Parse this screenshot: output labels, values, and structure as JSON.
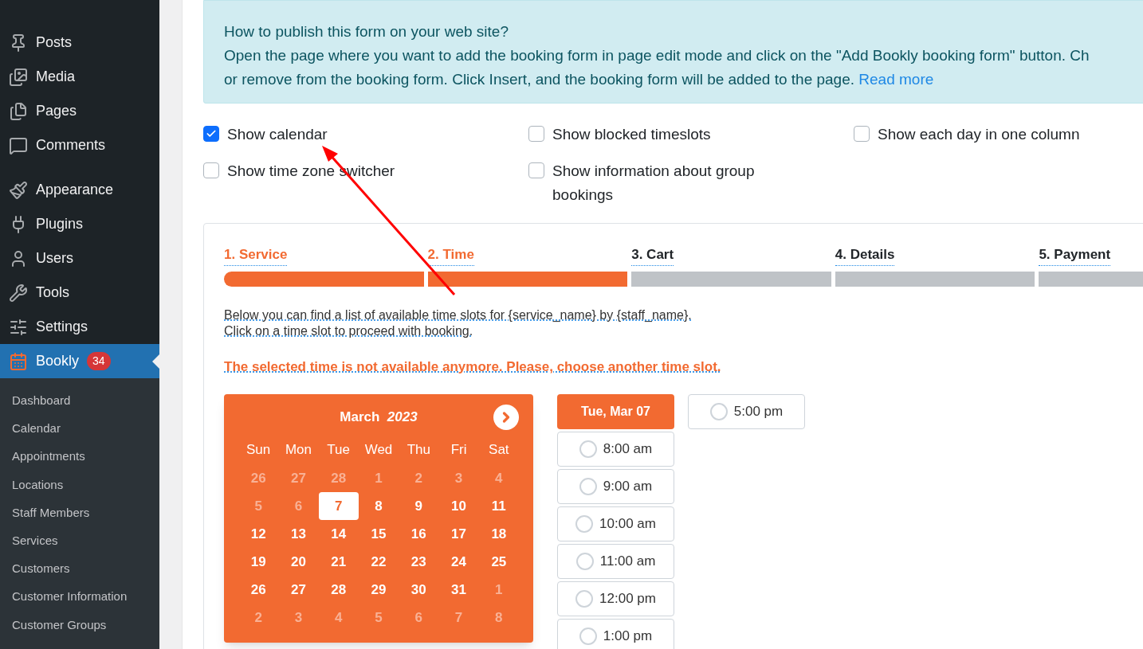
{
  "sidebar": {
    "items": [
      {
        "label": "Posts",
        "selected": false
      },
      {
        "label": "Media",
        "selected": false
      },
      {
        "label": "Pages",
        "selected": false
      },
      {
        "label": "Comments",
        "selected": false
      },
      {
        "label": "Appearance",
        "selected": false
      },
      {
        "label": "Plugins",
        "selected": false
      },
      {
        "label": "Users",
        "selected": false
      },
      {
        "label": "Tools",
        "selected": false
      },
      {
        "label": "Settings",
        "selected": false
      },
      {
        "label": "Bookly",
        "selected": true,
        "badge": "34"
      }
    ],
    "submenu": [
      "Dashboard",
      "Calendar",
      "Appointments",
      "Locations",
      "Staff Members",
      "Services",
      "Customers",
      "Customer Information",
      "Customer Groups"
    ]
  },
  "info": {
    "lines": [
      "How to publish this form on your web site?",
      "Open the page where you want to add the booking form in page edit mode and click on the \"Add Bookly booking form\" button. Ch",
      "or remove from the booking form. Click Insert, and the booking form will be added to the page."
    ],
    "link": "Read more"
  },
  "options": [
    {
      "label": "Show calendar",
      "checked": true
    },
    {
      "label": "Show blocked timeslots",
      "checked": false
    },
    {
      "label": "Show each day in one column",
      "checked": false
    },
    {
      "label": "Show time zone switcher",
      "checked": false
    },
    {
      "label": "Show information about group bookings",
      "checked": false
    }
  ],
  "steps": [
    {
      "number": "1.",
      "label": "Service",
      "active": true
    },
    {
      "number": "2.",
      "label": "Time",
      "active": true
    },
    {
      "number": "3.",
      "label": "Cart",
      "active": false
    },
    {
      "number": "4.",
      "label": "Details",
      "active": false
    },
    {
      "number": "5.",
      "label": "Payment",
      "active": false
    }
  ],
  "intro": [
    "Below you can find a list of available time slots for {service_name} by {staff_name}.",
    "Click on a time slot to proceed with booking."
  ],
  "error": "The selected time is not available anymore. Please, choose another time slot.",
  "calendar": {
    "month": "March",
    "year": "2023",
    "weekdays": [
      "Sun",
      "Mon",
      "Tue",
      "Wed",
      "Thu",
      "Fri",
      "Sat"
    ],
    "days": [
      {
        "label": "26",
        "muted": true,
        "selected": false
      },
      {
        "label": "27",
        "muted": true,
        "selected": false
      },
      {
        "label": "28",
        "muted": true,
        "selected": false
      },
      {
        "label": "1",
        "muted": true,
        "selected": false
      },
      {
        "label": "2",
        "muted": true,
        "selected": false
      },
      {
        "label": "3",
        "muted": true,
        "selected": false
      },
      {
        "label": "4",
        "muted": true,
        "selected": false
      },
      {
        "label": "5",
        "muted": true,
        "selected": false
      },
      {
        "label": "6",
        "muted": true,
        "selected": false
      },
      {
        "label": "7",
        "muted": false,
        "selected": true
      },
      {
        "label": "8",
        "muted": false,
        "selected": false
      },
      {
        "label": "9",
        "muted": false,
        "selected": false
      },
      {
        "label": "10",
        "muted": false,
        "selected": false
      },
      {
        "label": "11",
        "muted": false,
        "selected": false
      },
      {
        "label": "12",
        "muted": false,
        "selected": false
      },
      {
        "label": "13",
        "muted": false,
        "selected": false
      },
      {
        "label": "14",
        "muted": false,
        "selected": false
      },
      {
        "label": "15",
        "muted": false,
        "selected": false
      },
      {
        "label": "16",
        "muted": false,
        "selected": false
      },
      {
        "label": "17",
        "muted": false,
        "selected": false
      },
      {
        "label": "18",
        "muted": false,
        "selected": false
      },
      {
        "label": "19",
        "muted": false,
        "selected": false
      },
      {
        "label": "20",
        "muted": false,
        "selected": false
      },
      {
        "label": "21",
        "muted": false,
        "selected": false
      },
      {
        "label": "22",
        "muted": false,
        "selected": false
      },
      {
        "label": "23",
        "muted": false,
        "selected": false
      },
      {
        "label": "24",
        "muted": false,
        "selected": false
      },
      {
        "label": "25",
        "muted": false,
        "selected": false
      },
      {
        "label": "26",
        "muted": false,
        "selected": false
      },
      {
        "label": "27",
        "muted": false,
        "selected": false
      },
      {
        "label": "28",
        "muted": false,
        "selected": false
      },
      {
        "label": "29",
        "muted": false,
        "selected": false
      },
      {
        "label": "30",
        "muted": false,
        "selected": false
      },
      {
        "label": "31",
        "muted": false,
        "selected": false
      },
      {
        "label": "1",
        "muted": true,
        "selected": false
      },
      {
        "label": "2",
        "muted": true,
        "selected": false
      },
      {
        "label": "3",
        "muted": true,
        "selected": false
      },
      {
        "label": "4",
        "muted": true,
        "selected": false
      },
      {
        "label": "5",
        "muted": true,
        "selected": false
      },
      {
        "label": "6",
        "muted": true,
        "selected": false
      },
      {
        "label": "7",
        "muted": true,
        "selected": false
      },
      {
        "label": "8",
        "muted": true,
        "selected": false
      }
    ]
  },
  "slot_columns": [
    {
      "header": "Tue, Mar 07",
      "slots": [
        {
          "time": "8:00 am",
          "selected": false
        },
        {
          "time": "9:00 am",
          "selected": false
        },
        {
          "time": "10:00 am",
          "selected": false
        },
        {
          "time": "11:00 am",
          "selected": false
        },
        {
          "time": "12:00 pm",
          "selected": false
        },
        {
          "time": "1:00 pm",
          "selected": false
        }
      ]
    },
    {
      "slots": [
        {
          "time": "5:00 pm",
          "selected": false
        }
      ]
    }
  ]
}
